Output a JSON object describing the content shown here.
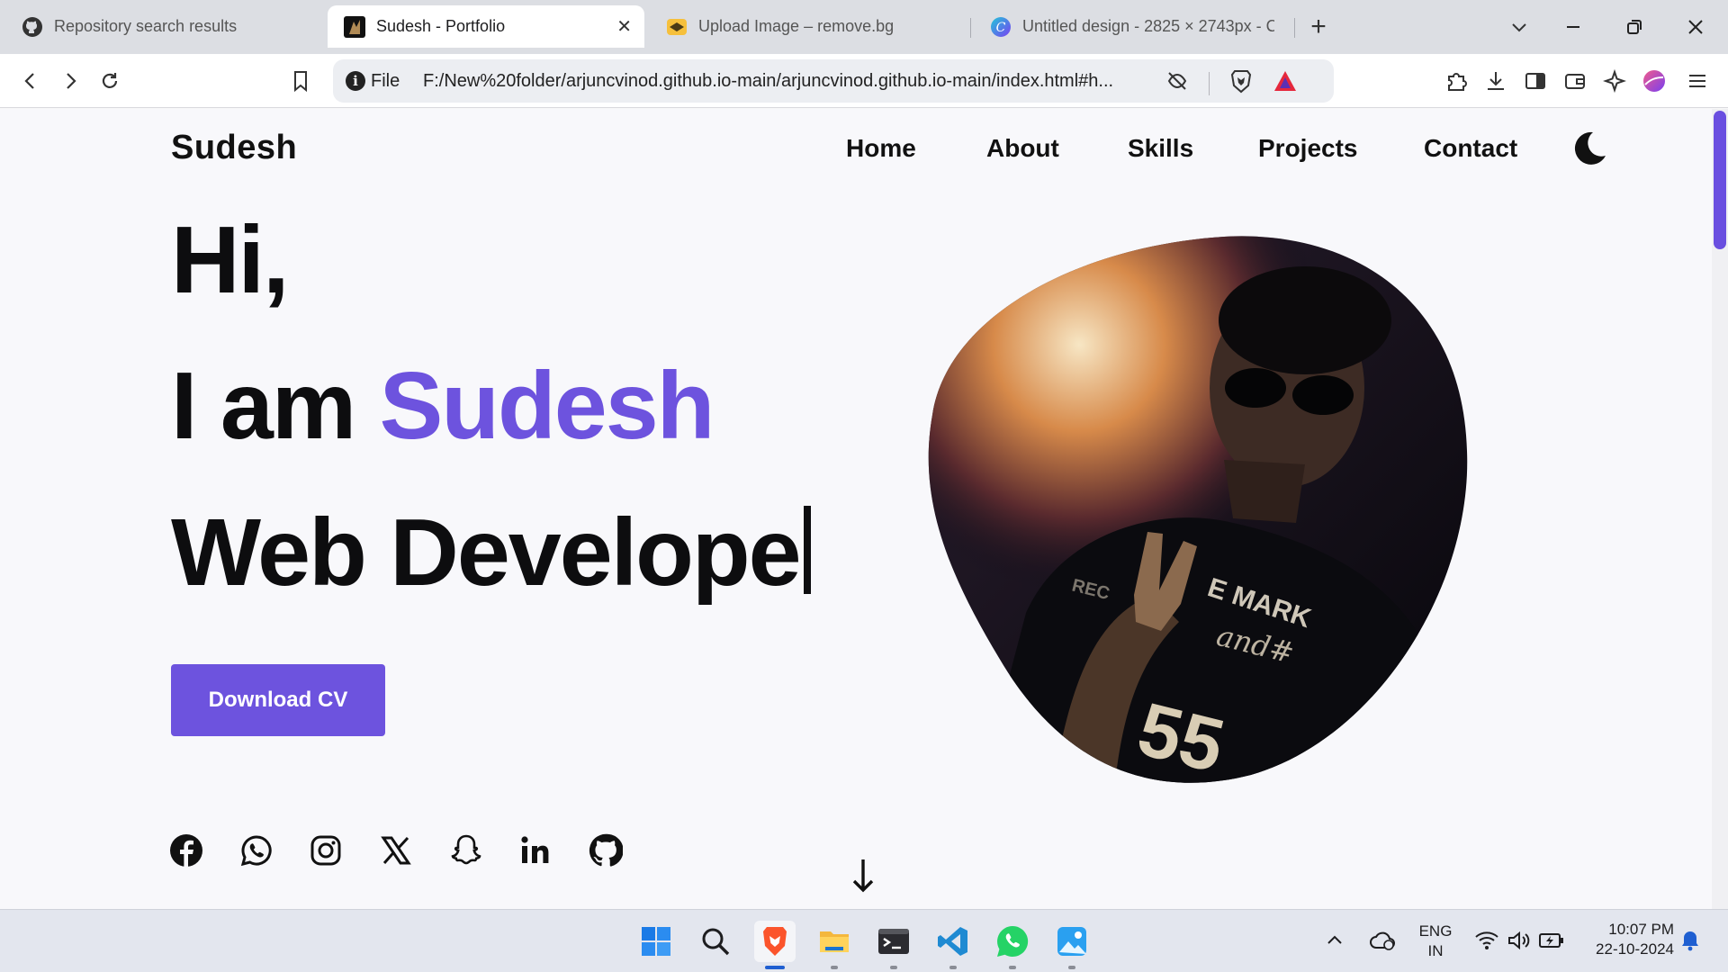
{
  "browser": {
    "tabs": [
      {
        "title": "Repository search results",
        "icon": "github-icon",
        "active": false
      },
      {
        "title": "Sudesh - Portfolio",
        "icon": "site-favicon",
        "active": true
      },
      {
        "title": "Upload Image – remove.bg",
        "icon": "removebg-icon",
        "active": false
      },
      {
        "title": "Untitled design - 2825 × 2743px - C",
        "icon": "canva-icon",
        "active": false
      }
    ],
    "close_glyph": "✕",
    "new_tab_glyph": "+",
    "omnibox": {
      "scheme_label": "File",
      "url": "F:/New%20folder/arjuncvinod.github.io-main/arjuncvinod.github.io-main/index.html#h..."
    }
  },
  "page": {
    "logo": "Sudesh",
    "nav": [
      "Home",
      "About",
      "Skills",
      "Projects",
      "Contact"
    ],
    "hero": {
      "greeting": "Hi,",
      "intro_prefix": "I am ",
      "name": "Sudesh",
      "role_typed": "Web Develope"
    },
    "cta_label": "Download CV",
    "socials": [
      "facebook-icon",
      "whatsapp-icon",
      "instagram-icon",
      "x-icon",
      "snapchat-icon",
      "linkedin-icon",
      "github-icon"
    ],
    "accent_color": "#6d53de"
  },
  "taskbar": {
    "apps": [
      "windows-start-icon",
      "search-icon",
      "brave-browser-icon",
      "file-explorer-icon",
      "terminal-icon",
      "vscode-icon",
      "whatsapp-icon",
      "photos-icon"
    ],
    "tray": {
      "language_top": "ENG",
      "language_bottom": "IN",
      "time": "10:07 PM",
      "date": "22-10-2024"
    }
  }
}
